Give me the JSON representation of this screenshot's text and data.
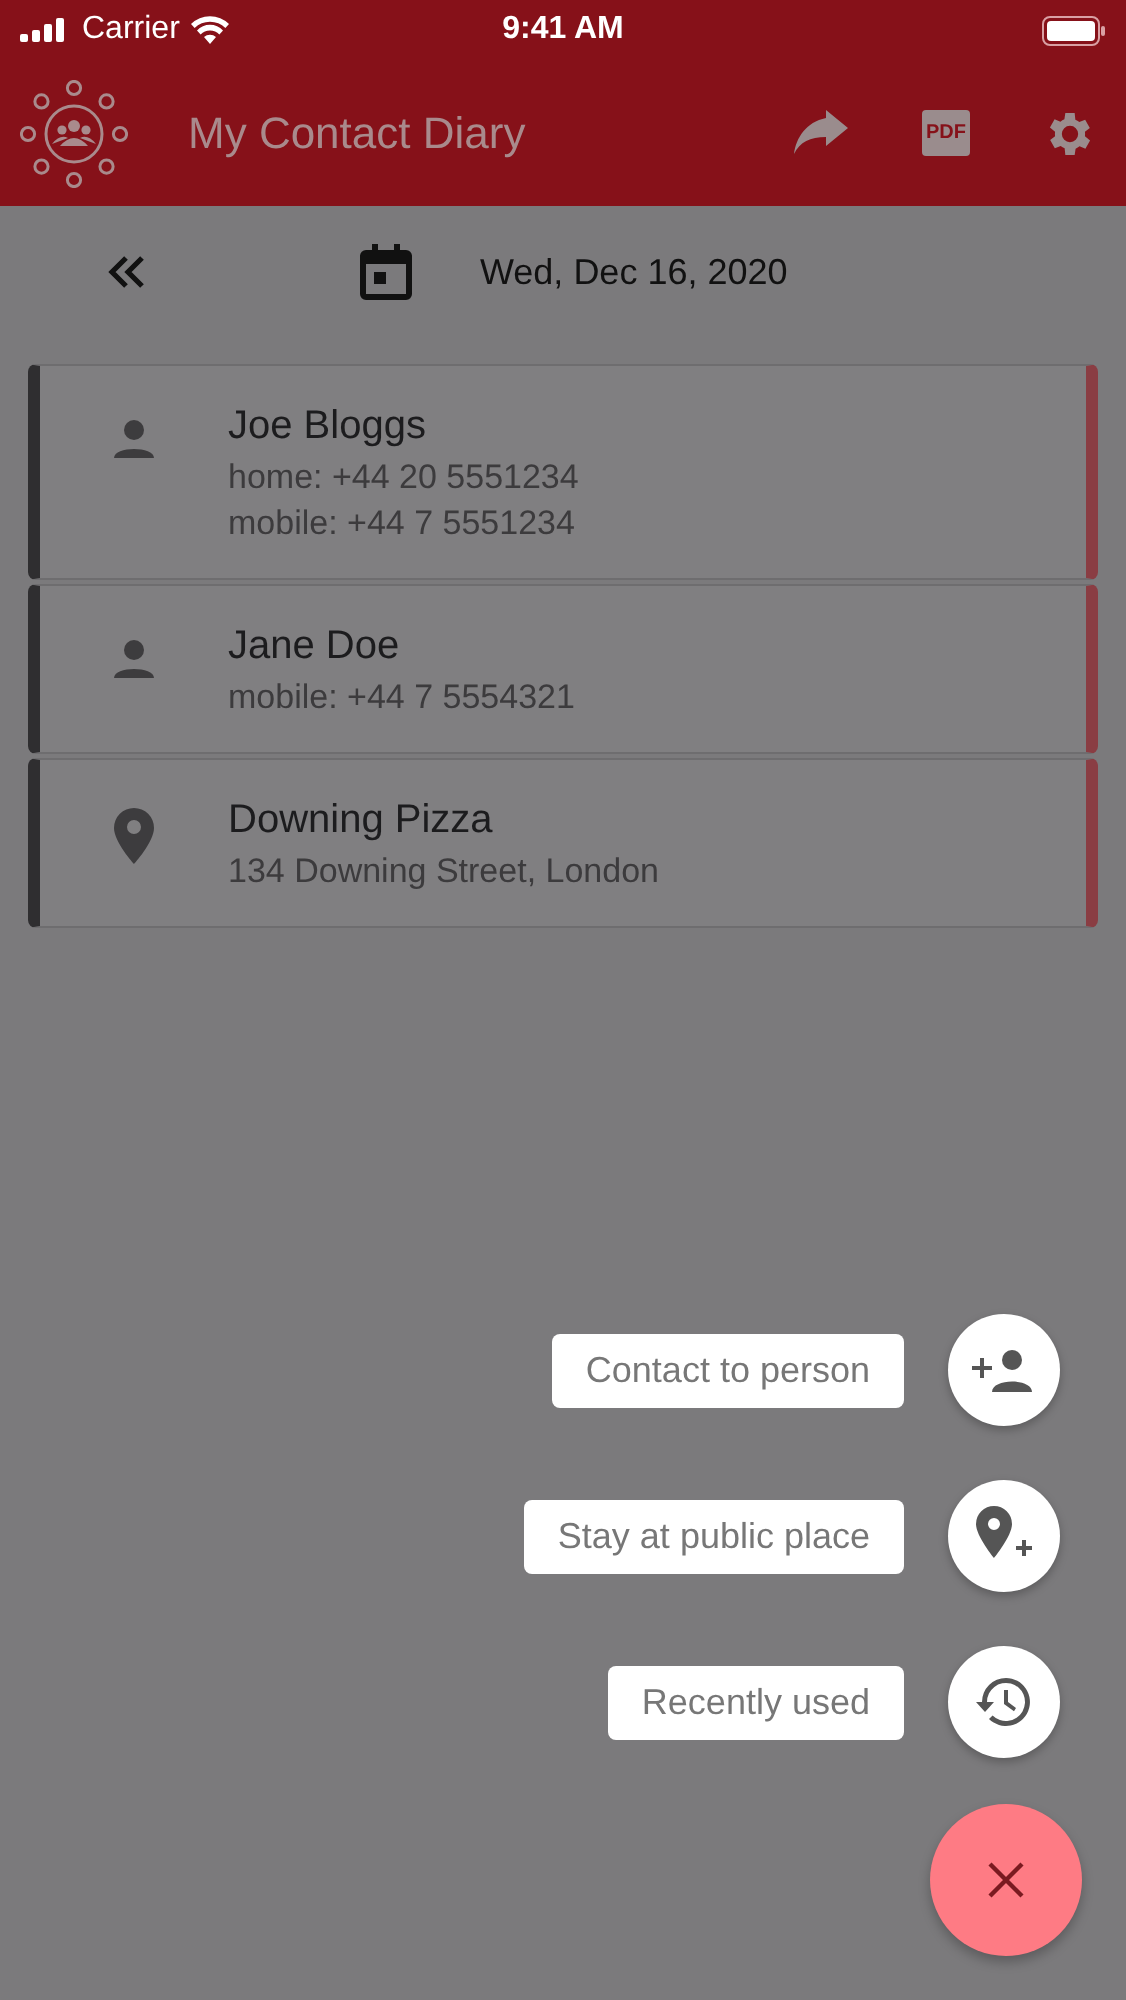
{
  "status_bar": {
    "carrier": "Carrier",
    "time": "9:41 AM"
  },
  "header": {
    "title": "My Contact Diary",
    "pdf_label": "PDF"
  },
  "date_bar": {
    "date": "Wed, Dec 16, 2020"
  },
  "entries": [
    {
      "kind": "person",
      "name": "Joe Bloggs",
      "details": [
        "home: +44 20 5551234",
        "mobile: +44 7 5551234"
      ]
    },
    {
      "kind": "person",
      "name": "Jane Doe",
      "details": [
        "mobile: +44 7 5554321"
      ]
    },
    {
      "kind": "place",
      "name": "Downing Pizza",
      "details": [
        "134 Downing Street, London"
      ]
    }
  ],
  "speed_dial": {
    "open": true,
    "actions": [
      {
        "kind": "add_person",
        "label": "Contact to person"
      },
      {
        "kind": "add_place",
        "label": "Stay at public place"
      },
      {
        "kind": "history",
        "label": "Recently used"
      }
    ]
  }
}
